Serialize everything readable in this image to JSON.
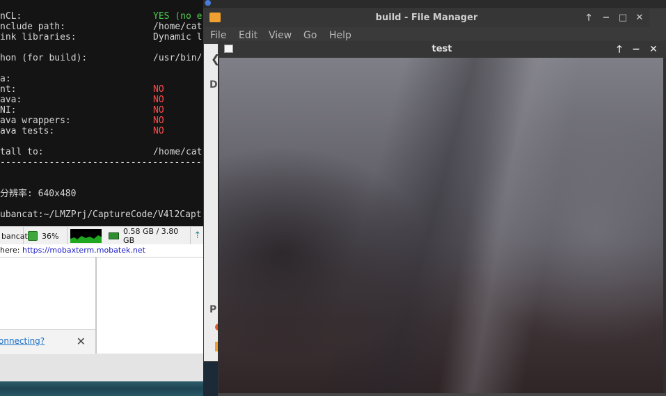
{
  "terminal": {
    "lines": [
      {
        "label": "nCL:",
        "value": "YES (no e",
        "color": "green"
      },
      {
        "label": "nclude path:",
        "value": "/home/cat",
        "color": "default"
      },
      {
        "label": "ink libraries:",
        "value": "Dynamic l",
        "color": "default"
      },
      {
        "label": "",
        "value": "",
        "color": "default"
      },
      {
        "label": "hon (for build):",
        "value": "/usr/bin/",
        "color": "default"
      },
      {
        "label": "",
        "value": "",
        "color": "default"
      },
      {
        "label": "a:",
        "value": "",
        "color": "default"
      },
      {
        "label": "nt:",
        "value": "NO",
        "color": "red"
      },
      {
        "label": "ava:",
        "value": "NO",
        "color": "red"
      },
      {
        "label": "NI:",
        "value": "NO",
        "color": "red"
      },
      {
        "label": "ava wrappers:",
        "value": "NO",
        "color": "red"
      },
      {
        "label": "ava tests:",
        "value": "NO",
        "color": "red"
      },
      {
        "label": "",
        "value": "",
        "color": "default"
      },
      {
        "label": "tall to:",
        "value": "/home/cat",
        "color": "default"
      },
      {
        "label": "----------------------------------------",
        "value": "",
        "color": "default"
      },
      {
        "label": "",
        "value": "",
        "color": "default"
      },
      {
        "label": "",
        "value": "",
        "color": "default"
      },
      {
        "label": "分辨率: 640x480",
        "value": "",
        "color": "default"
      },
      {
        "label": "",
        "value": "",
        "color": "default"
      },
      {
        "label": "ubancat:~/LMZPrj/CaptureCode/V4l2Capt",
        "value": "",
        "color": "default"
      }
    ]
  },
  "statusbar": {
    "host": "bancat",
    "cpu": "36%",
    "ram": "0.58 GB / 3.80 GB"
  },
  "infobar": {
    "prefix": "here: ",
    "link": "https://mobaxterm.mobatek.net"
  },
  "notification": {
    "link_text": "onnecting?",
    "close": "✕"
  },
  "file_manager": {
    "title": "build - File Manager",
    "menu": [
      "File",
      "Edit",
      "View",
      "Go",
      "Help"
    ],
    "side_label_top": "D",
    "side_label_bottom": "P",
    "controls": [
      "🡑",
      "−",
      "□",
      "✕"
    ]
  },
  "test_window": {
    "title": "test",
    "controls": [
      "🡑",
      "−",
      "✕"
    ]
  },
  "colors": {
    "terminal_green": "#4fcf4f",
    "terminal_red": "#ff4a4a",
    "titlebar": "#363636",
    "link": "#1a1ac8"
  }
}
